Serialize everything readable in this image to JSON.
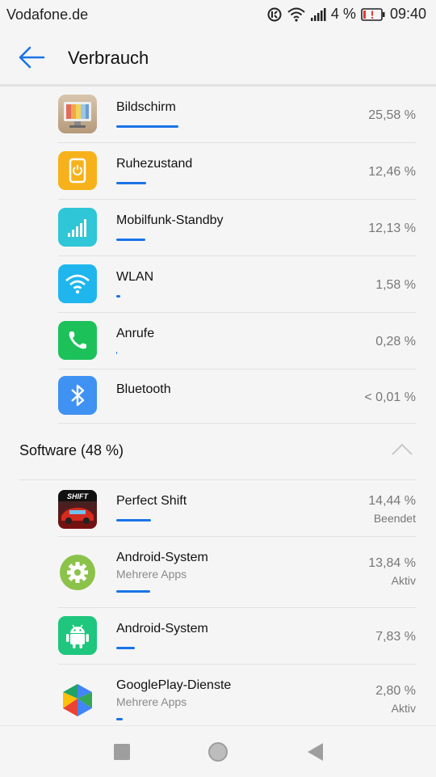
{
  "statusbar": {
    "carrier": "Vodafone.de",
    "battery_pct": "4 %",
    "time": "09:40"
  },
  "appbar": {
    "title": "Verbrauch"
  },
  "hardware": [
    {
      "name": "Bildschirm",
      "pct": "25,58 %",
      "bar": 0.2558,
      "icon": "screen-icon"
    },
    {
      "name": "Ruhezustand",
      "pct": "12,46 %",
      "bar": 0.1246,
      "icon": "standby-icon"
    },
    {
      "name": "Mobilfunk-Standby",
      "pct": "12,13 %",
      "bar": 0.1213,
      "icon": "signal-icon"
    },
    {
      "name": "WLAN",
      "pct": "1,58 %",
      "bar": 0.0158,
      "icon": "wifi-icon"
    },
    {
      "name": "Anrufe",
      "pct": "0,28 %",
      "bar": 0.0028,
      "icon": "phone-icon"
    },
    {
      "name": "Bluetooth",
      "pct": "< 0,01 %",
      "bar": 0.0,
      "icon": "bluetooth-icon"
    }
  ],
  "software_section": {
    "label": "Software (48 %)"
  },
  "software": [
    {
      "name": "Perfect Shift",
      "sub": "",
      "pct": "14,44 %",
      "state": "Beendet",
      "bar": 0.1444,
      "icon": "perfect-shift-icon"
    },
    {
      "name": "Android-System",
      "sub": "Mehrere Apps",
      "pct": "13,84 %",
      "state": "Aktiv",
      "bar": 0.1384,
      "icon": "android-settings-icon"
    },
    {
      "name": "Android-System",
      "sub": "",
      "pct": "7,83 %",
      "state": "",
      "bar": 0.0783,
      "icon": "android-robot-icon"
    },
    {
      "name": "GooglePlay-Dienste",
      "sub": "Mehrere Apps",
      "pct": "2,80 %",
      "state": "Aktiv",
      "bar": 0.028,
      "icon": "google-play-services-icon"
    }
  ],
  "colors": {
    "accent": "#1a73e8",
    "bar": "#1a73e8"
  }
}
